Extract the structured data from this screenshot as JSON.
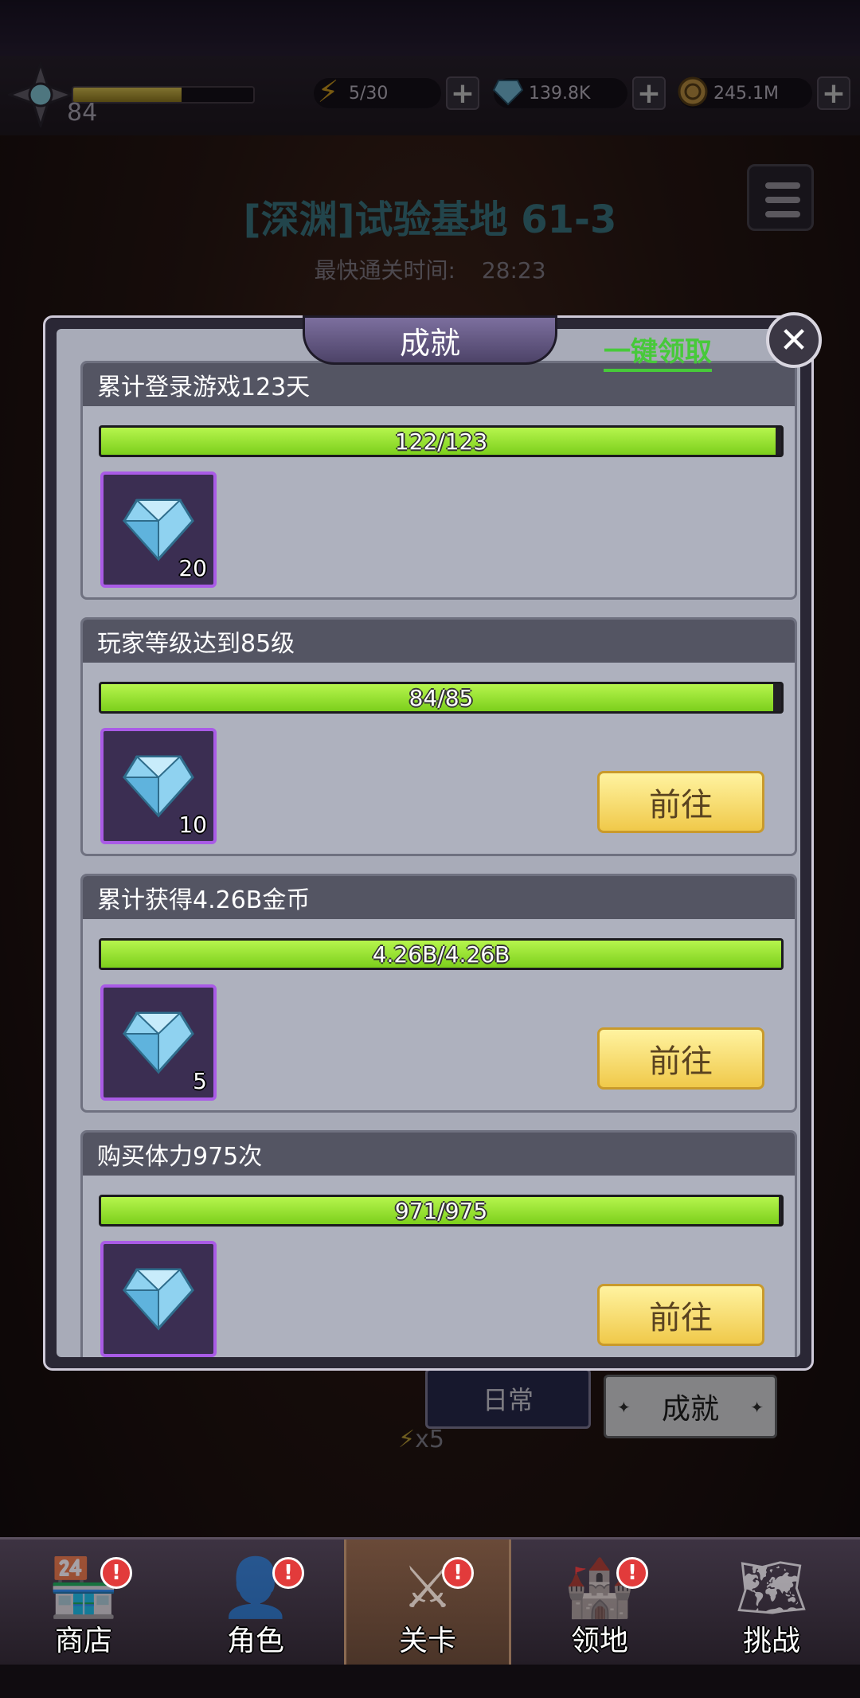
{
  "header": {
    "level": "84",
    "xp_fraction": 0.6,
    "energy": "5/30",
    "gems": "139.8K",
    "gold": "245.1M"
  },
  "stage": {
    "title": "[深渊]试验基地 61-3",
    "fastest_label": "最快通关时间:",
    "fastest_time": "28:23"
  },
  "modal": {
    "title": "成就",
    "claim_all": "一键领取",
    "goto_label": "前往",
    "cards": [
      {
        "title": "累计登录游戏123天",
        "progress": "122/123",
        "fraction": 0.992,
        "reward": "20",
        "show_goto": false
      },
      {
        "title": "玩家等级达到85级",
        "progress": "84/85",
        "fraction": 0.988,
        "reward": "10",
        "show_goto": true
      },
      {
        "title": "累计获得4.26B金币",
        "progress": "4.26B/4.26B",
        "fraction": 1.0,
        "reward": "5",
        "show_goto": true
      },
      {
        "title": "购买体力975次",
        "progress": "971/975",
        "fraction": 0.996,
        "reward": "",
        "show_goto": true
      }
    ]
  },
  "tabs": {
    "daily": "日常",
    "achievements": "成就",
    "energy_multiplier": "x5"
  },
  "nav": [
    {
      "label": "商店",
      "icon": "shop-icon",
      "badge": "!"
    },
    {
      "label": "角色",
      "icon": "character-icon",
      "badge": "!"
    },
    {
      "label": "关卡",
      "icon": "crossed-swords-icon",
      "badge": "!"
    },
    {
      "label": "领地",
      "icon": "castle-icon",
      "badge": "!"
    },
    {
      "label": "挑战",
      "icon": "map-icon",
      "badge": ""
    }
  ],
  "colors": {
    "progress_fill": "#9ee23a",
    "reward_border": "#a95be6",
    "claim_all": "#47c93a",
    "goto_button": "#f7dd6f"
  }
}
